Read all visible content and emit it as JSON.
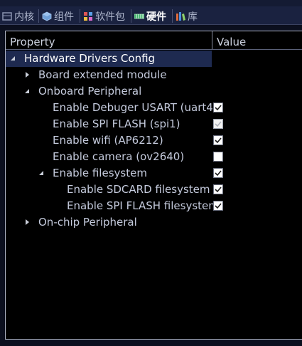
{
  "tabs": [
    {
      "label": "内核",
      "icon": "kernel-icon",
      "active": false
    },
    {
      "label": "组件",
      "icon": "component-cube-icon",
      "active": false
    },
    {
      "label": "软件包",
      "icon": "package-grid-icon",
      "active": false
    },
    {
      "label": "硬件",
      "icon": "hardware-board-icon",
      "active": true
    },
    {
      "label": "库",
      "icon": "library-icon",
      "active": false
    }
  ],
  "table": {
    "property_header": "Property",
    "value_header": "Value"
  },
  "tree": [
    {
      "label": "Hardware Drivers Config",
      "level": 0,
      "expander": "open",
      "checkbox": null,
      "selected": true
    },
    {
      "label": "Board extended module",
      "level": 1,
      "expander": "closed",
      "checkbox": null,
      "selected": false
    },
    {
      "label": "Onboard Peripheral",
      "level": 1,
      "expander": "open",
      "checkbox": null,
      "selected": false
    },
    {
      "label": "Enable Debuger USART (uart4)",
      "level": 2,
      "expander": null,
      "checkbox": "checked",
      "selected": false
    },
    {
      "label": "Enable SPI FLASH (spi1)",
      "level": 2,
      "expander": null,
      "checkbox": "checked-disabled",
      "selected": false
    },
    {
      "label": "Enable wifi (AP6212)",
      "level": 2,
      "expander": null,
      "checkbox": "checked",
      "selected": false
    },
    {
      "label": "Enable camera (ov2640)",
      "level": 2,
      "expander": null,
      "checkbox": "unchecked",
      "selected": false
    },
    {
      "label": "Enable filesystem",
      "level": 2,
      "expander": "open",
      "checkbox": "checked",
      "selected": false
    },
    {
      "label": "Enable SDCARD filesystem",
      "level": 3,
      "expander": null,
      "checkbox": "checked",
      "selected": false
    },
    {
      "label": "Enable SPI FLASH filesystem",
      "level": 3,
      "expander": null,
      "checkbox": "checked",
      "selected": false
    },
    {
      "label": "On-chip Peripheral",
      "level": 1,
      "expander": "closed",
      "checkbox": null,
      "selected": false
    }
  ],
  "colors": {
    "background": "#000000",
    "tab_strip": "#1a2240",
    "selection": "#1e2a50",
    "text": "#c4cadc",
    "check": "#1a1a1a",
    "check_disabled": "#b0b4bc"
  }
}
